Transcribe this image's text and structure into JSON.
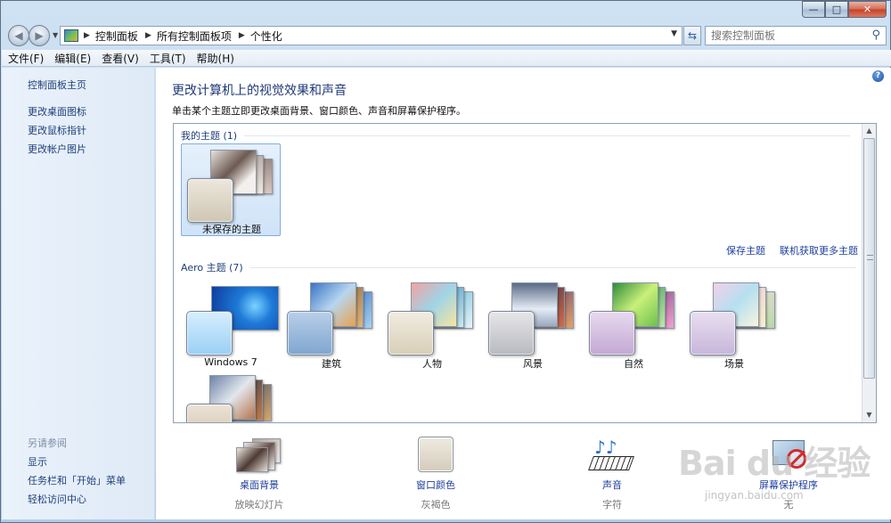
{
  "window": {
    "controls": {
      "minimize": "—",
      "maximize": "□",
      "close": "✕"
    }
  },
  "nav": {
    "back": "◀",
    "forward": "▶",
    "breadcrumbs": [
      "控制面板",
      "所有控制面板项",
      "个性化"
    ],
    "search_placeholder": "搜索控制面板"
  },
  "menu": [
    "文件(F)",
    "编辑(E)",
    "查看(V)",
    "工具(T)",
    "帮助(H)"
  ],
  "sidebar": {
    "home": "控制面板主页",
    "links": [
      "更改桌面图标",
      "更改鼠标指针",
      "更改帐户图片"
    ],
    "see_also_heading": "另请参阅",
    "see_also": [
      "显示",
      "任务栏和「开始」菜单",
      "轻松访问中心"
    ]
  },
  "main": {
    "help": "?",
    "title": "更改计算机上的视觉效果和声音",
    "description": "单击某个主题立即更改桌面背景、窗口颜色、声音和屏幕保护程序。",
    "my_themes": {
      "heading": "我的主题 (1)",
      "items": [
        {
          "label": "未保存的主题",
          "selected": true
        }
      ]
    },
    "links": [
      "保存主题",
      "联机获取更多主题"
    ],
    "aero_themes": {
      "heading": "Aero 主题 (7)",
      "items": [
        {
          "label": "Windows 7"
        },
        {
          "label": "建筑"
        },
        {
          "label": "人物"
        },
        {
          "label": "风景"
        },
        {
          "label": "自然"
        },
        {
          "label": "场景"
        },
        {
          "label": ""
        }
      ]
    }
  },
  "settings": [
    {
      "label": "桌面背景",
      "value": "放映幻灯片"
    },
    {
      "label": "窗口颜色",
      "value": "灰褐色"
    },
    {
      "label": "声音",
      "value": "字符"
    },
    {
      "label": "屏幕保护程序",
      "value": "无"
    }
  ],
  "watermark": {
    "text": "Bai du 经验",
    "sub": "jingyan.baidu.com"
  },
  "colors": {
    "link": "#1e3f9e",
    "title": "#1e3a78",
    "window_frame": "#bcd4ea"
  }
}
